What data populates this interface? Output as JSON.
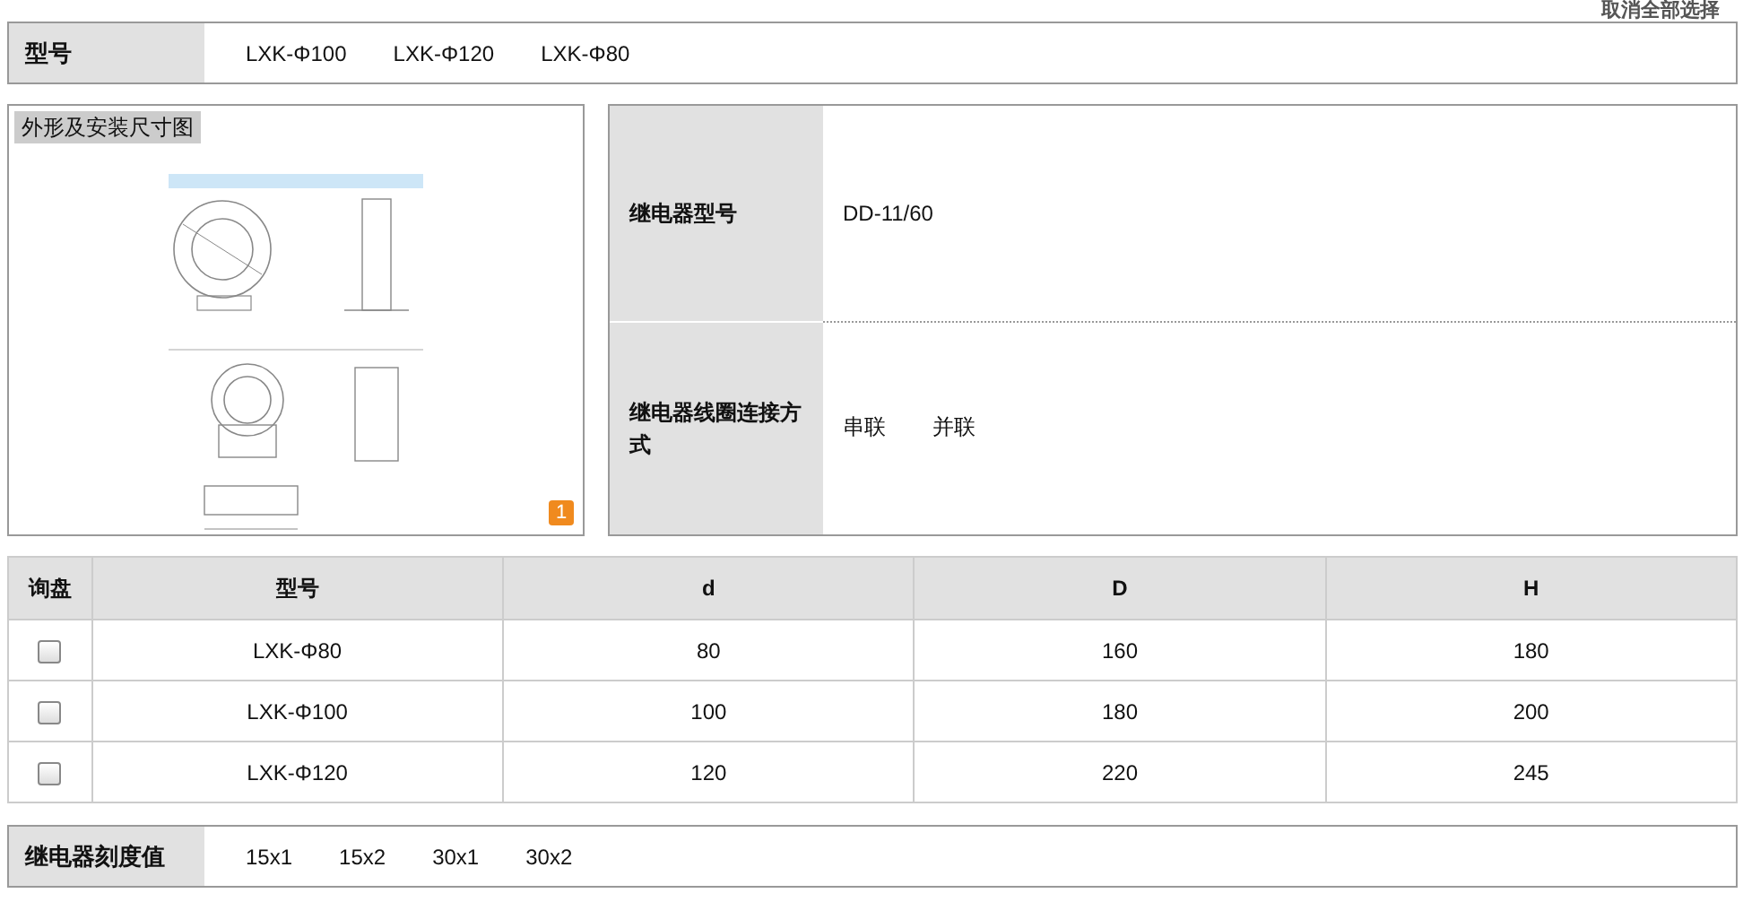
{
  "top_link": "取消全部选择",
  "model_bar": {
    "label": "型号",
    "options": [
      "LXK-Φ100",
      "LXK-Φ120",
      "LXK-Φ80"
    ]
  },
  "drawing_panel": {
    "title": "外形及安装尺寸图",
    "badge": "1"
  },
  "relay_specs": [
    {
      "label": "继电器型号",
      "values": [
        "DD-11/60"
      ]
    },
    {
      "label": "继电器线圈连接方式",
      "values": [
        "串联",
        "并联"
      ]
    }
  ],
  "table": {
    "columns": [
      "询盘",
      "型号",
      "d",
      "D",
      "H"
    ],
    "rows": [
      {
        "cells": [
          {
            "kind": "checkbox",
            "checked": false
          },
          "LXK-Φ80",
          "80",
          "160",
          "180"
        ]
      },
      {
        "cells": [
          {
            "kind": "checkbox",
            "checked": false
          },
          "LXK-Φ100",
          "100",
          "180",
          "200"
        ]
      },
      {
        "cells": [
          {
            "kind": "checkbox",
            "checked": false
          },
          "LXK-Φ120",
          "120",
          "220",
          "245"
        ]
      }
    ]
  },
  "scale_bar": {
    "label": "继电器刻度值",
    "options": [
      "15x1",
      "15x2",
      "30x1",
      "30x2"
    ]
  }
}
